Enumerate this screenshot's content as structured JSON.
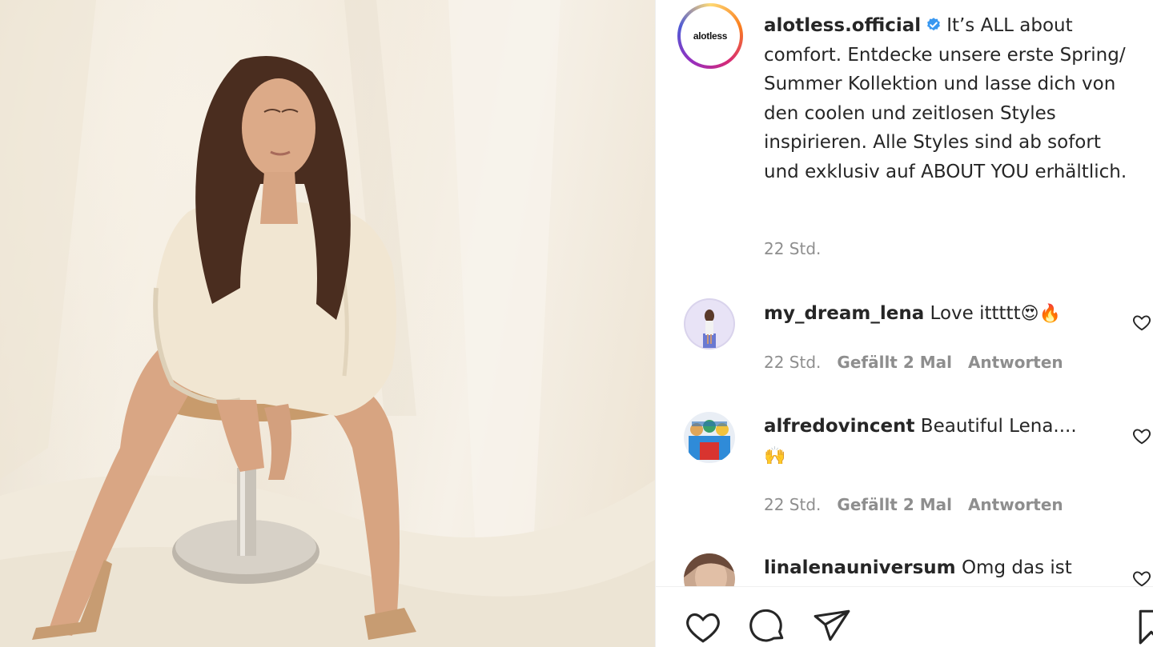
{
  "post": {
    "username": "alotless.official",
    "avatar_brand": "alotless",
    "caption": "It’s ALL about comfort. Entdecke unsere erste Spring/ Summer Kollektion und lasse dich von den coolen und zeitlosen Styles inspirieren. Alle Styles sind ab sofort und exklusiv auf ABOUT YOU erhältlich.",
    "time": "22 Std."
  },
  "comments": [
    {
      "username": "my_dream_lena",
      "text": "Love ittttt",
      "emojis": "😍🔥",
      "time": "22 Std.",
      "likes": "Gefällt 2 Mal",
      "reply": "Antworten"
    },
    {
      "username": "alfredovincent",
      "text": "Beautiful Lena....",
      "emojis": "🙌",
      "time": "22 Std.",
      "likes": "Gefällt 2 Mal",
      "reply": "Antworten"
    },
    {
      "username": "linalenauniversum",
      "text": "Omg das ist"
    }
  ],
  "icons": {
    "like": "heart-icon",
    "comment": "comment-icon",
    "share": "share-icon",
    "save": "bookmark-icon",
    "verified": "verified-badge-icon"
  },
  "colors": {
    "text": "#262626",
    "muted": "#8e8e8e",
    "verified": "#3897f0"
  }
}
